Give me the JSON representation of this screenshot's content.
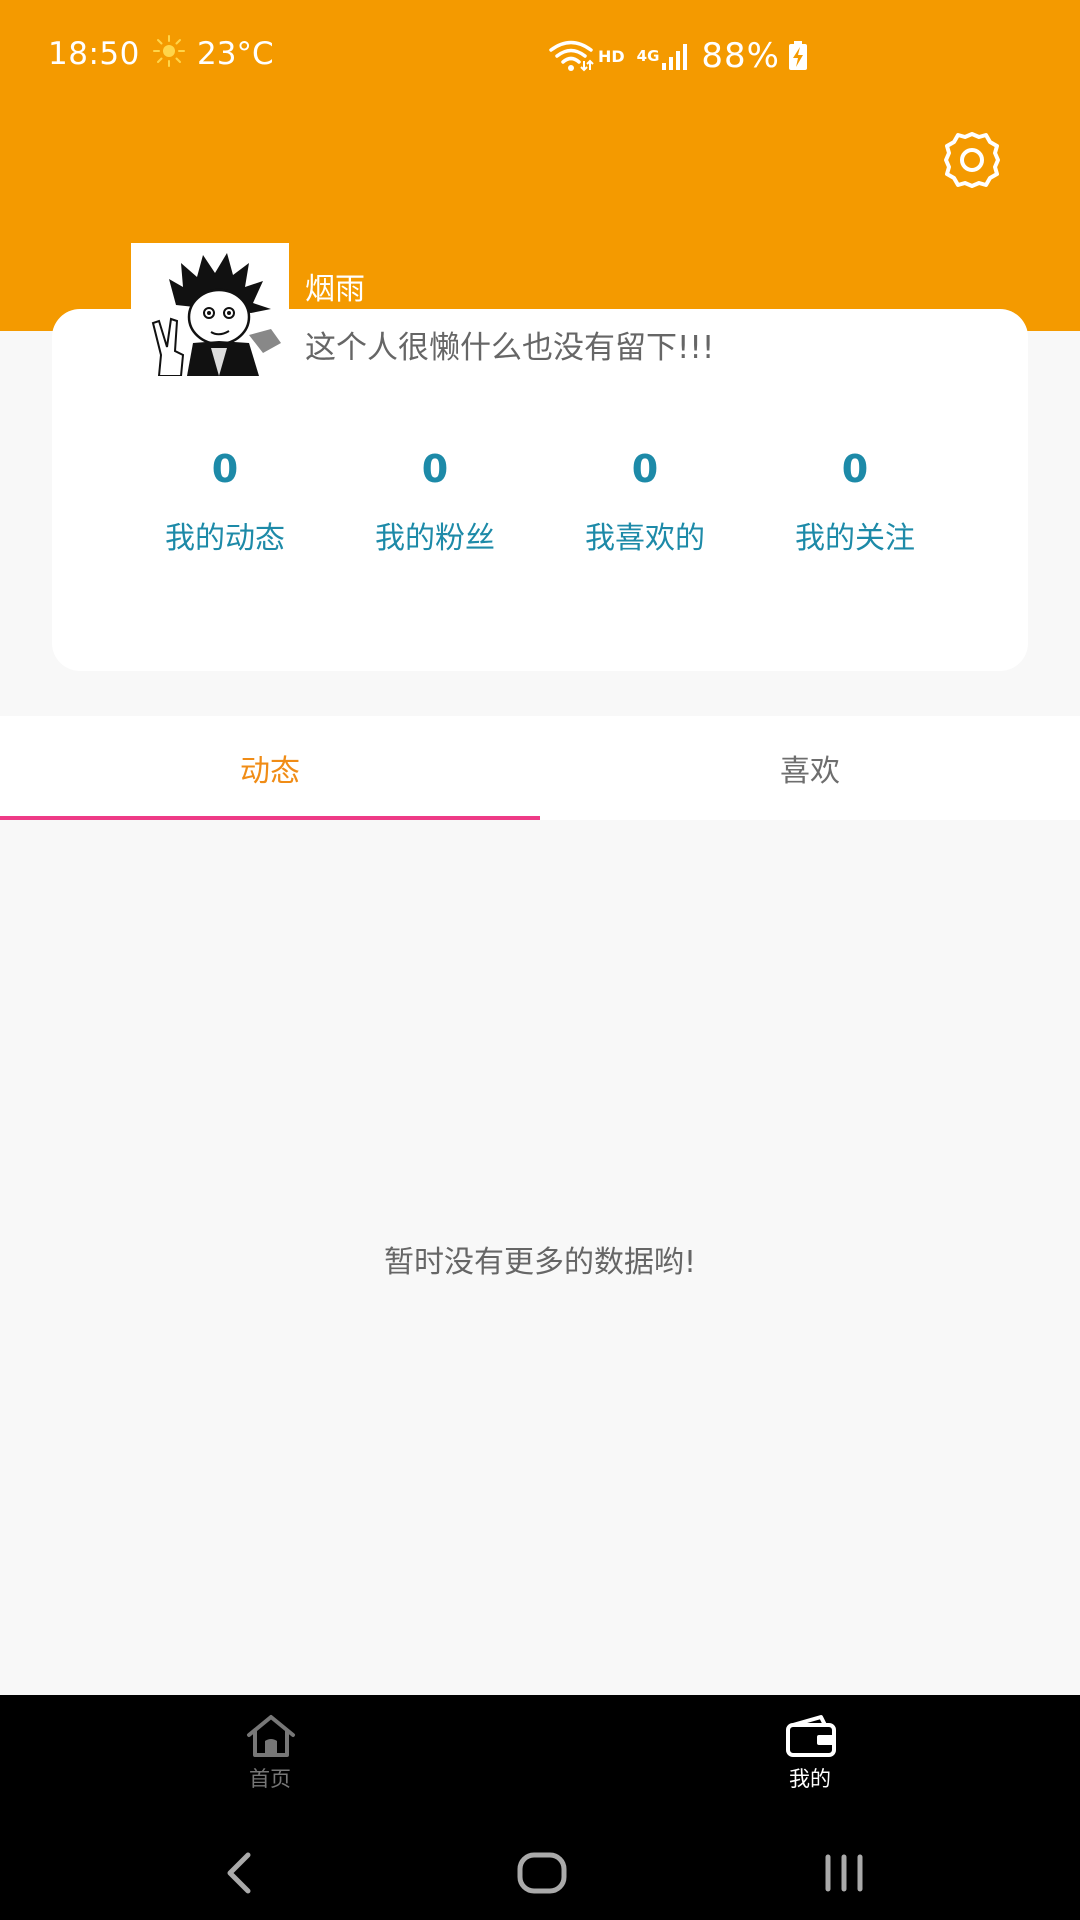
{
  "status_bar": {
    "time": "18:50",
    "temperature": "23°C",
    "network": "HD",
    "cellular": "4G",
    "battery": "88%"
  },
  "profile": {
    "username": "烟雨",
    "bio": "这个人很懒什么也没有留下!!!",
    "stats": [
      {
        "value": "0",
        "label": "我的动态"
      },
      {
        "value": "0",
        "label": "我的粉丝"
      },
      {
        "value": "0",
        "label": "我喜欢的"
      },
      {
        "value": "0",
        "label": "我的关注"
      }
    ]
  },
  "tabs": [
    {
      "label": "动态",
      "active": true
    },
    {
      "label": "喜欢",
      "active": false
    }
  ],
  "empty_message": "暂时没有更多的数据哟!",
  "bottom_nav": [
    {
      "label": "首页",
      "icon": "home-icon",
      "active": false
    },
    {
      "label": "我的",
      "icon": "wallet-icon",
      "active": true
    }
  ],
  "colors": {
    "header": "#f49a00",
    "stat_text": "#1d8aa8",
    "tab_active_text": "#f08c16",
    "tab_indicator": "#ee3a86"
  }
}
